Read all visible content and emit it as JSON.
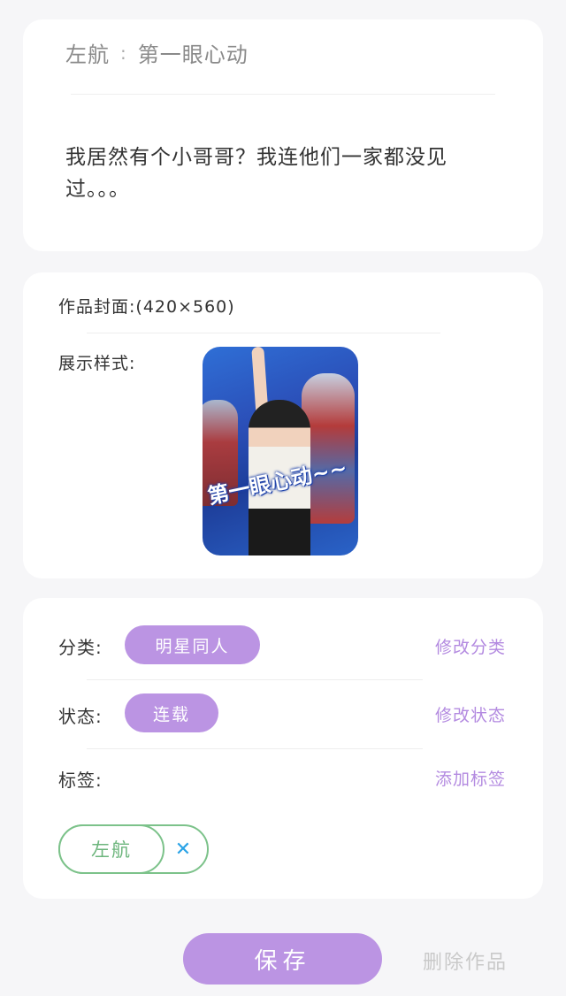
{
  "work": {
    "author": "左航",
    "separator": ":",
    "title": "第一眼心动",
    "description": "我居然有个小哥哥？我连他们一家都没见过。。。"
  },
  "cover": {
    "label": "作品封面:(420×560)",
    "style_label": "展示样式:",
    "image_caption": "第一眼心动~~"
  },
  "meta": {
    "category_label": "分类:",
    "category_value": "明星同人",
    "category_action": "修改分类",
    "status_label": "状态:",
    "status_value": "连载",
    "status_action": "修改状态",
    "tags_label": "标签:",
    "tags_action": "添加标签",
    "tags": [
      {
        "label": "左航",
        "remove_icon": "close-icon"
      }
    ]
  },
  "actions": {
    "save_label": "保存",
    "delete_label": "删除作品"
  },
  "colors": {
    "accent": "#bb94e3",
    "link": "#b38ae0",
    "tag_border": "#7cc28a",
    "tag_text": "#6cb57c",
    "remove_icon": "#2aa3e6",
    "delete_text": "#c9c9c9",
    "background": "#f6f6f8"
  }
}
